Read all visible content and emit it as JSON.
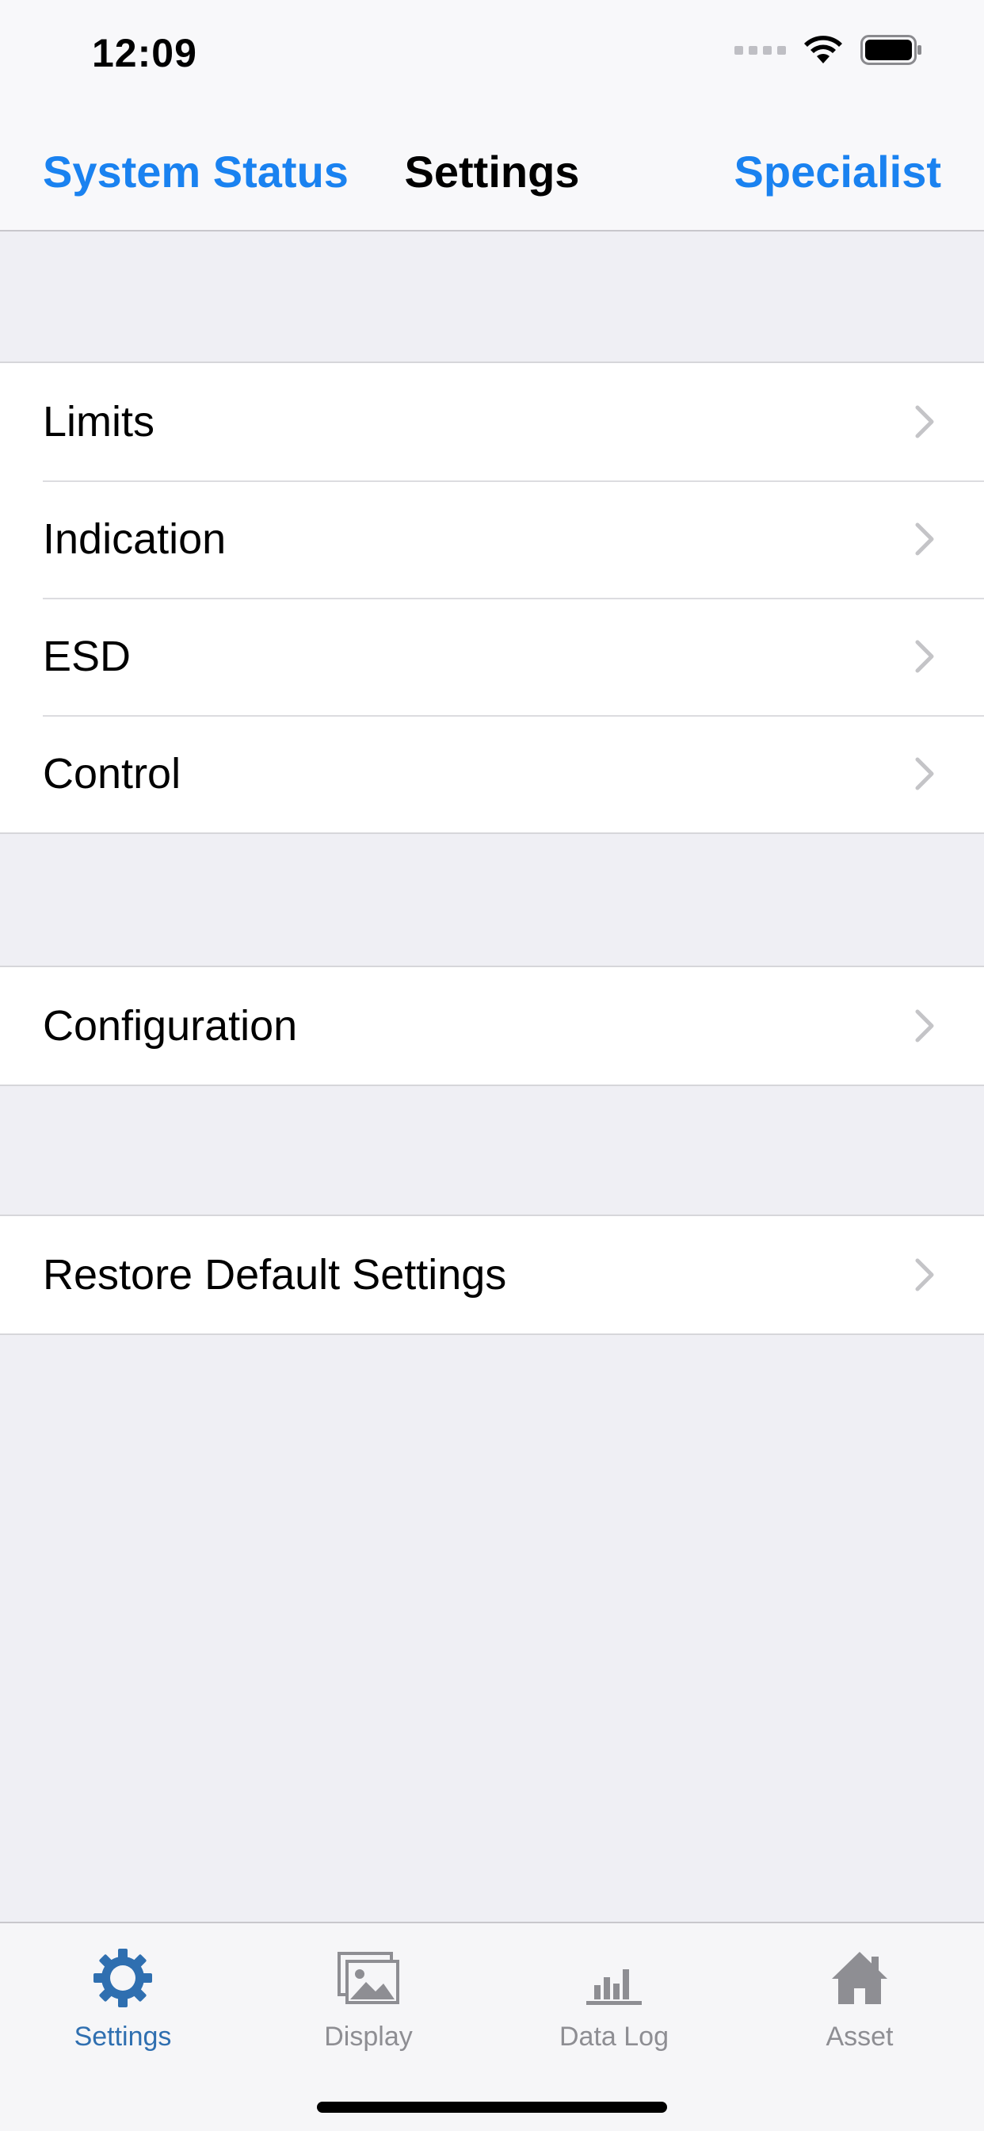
{
  "status_bar": {
    "time": "12:09",
    "icons": [
      "signal-dots-icon",
      "wifi-icon",
      "battery-icon"
    ]
  },
  "nav_bar": {
    "left_label": "System Status",
    "title": "Settings",
    "right_label": "Specialist"
  },
  "groups": [
    {
      "items": [
        {
          "label": "Limits"
        },
        {
          "label": "Indication"
        },
        {
          "label": "ESD"
        },
        {
          "label": "Control"
        }
      ]
    },
    {
      "items": [
        {
          "label": "Configuration"
        }
      ]
    },
    {
      "items": [
        {
          "label": "Restore Default Settings"
        }
      ]
    }
  ],
  "tab_bar": {
    "tabs": [
      {
        "label": "Settings",
        "icon": "gear-icon",
        "active": true
      },
      {
        "label": "Display",
        "icon": "image-icon",
        "active": false
      },
      {
        "label": "Data Log",
        "icon": "bar-chart-icon",
        "active": false
      },
      {
        "label": "Asset",
        "icon": "home-icon",
        "active": false
      }
    ]
  },
  "colors": {
    "accent": "#1a82f0",
    "tab_active": "#2f6fb0",
    "tab_inactive": "#8e8e93",
    "background": "#efeff4",
    "chevron": "#c4c4c7"
  }
}
